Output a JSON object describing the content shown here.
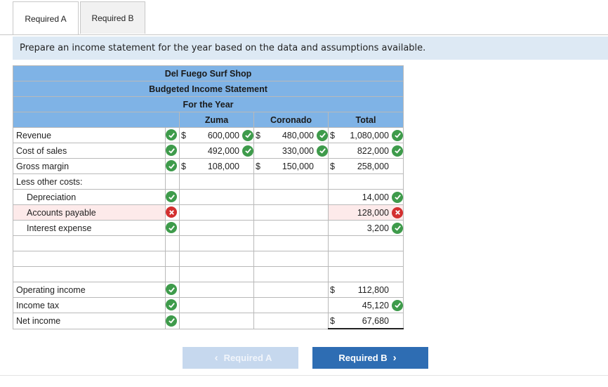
{
  "tabs": [
    {
      "label": "Required A"
    },
    {
      "label": "Required B"
    }
  ],
  "prompt": "Prepare an income statement for the year based on the data and assumptions available.",
  "statement": {
    "company": "Del Fuego Surf Shop",
    "title": "Budgeted Income Statement",
    "period": "For the Year",
    "columns": [
      "Zuma",
      "Coronado",
      "Total"
    ]
  },
  "rows": {
    "revenue": {
      "label": "Revenue",
      "zuma": "600,000",
      "coronado": "480,000",
      "total": "1,080,000"
    },
    "cost_of_sales": {
      "label": "Cost of sales",
      "zuma": "492,000",
      "coronado": "330,000",
      "total": "822,000"
    },
    "gross_margin": {
      "label": "Gross margin",
      "zuma": "108,000",
      "coronado": "150,000",
      "total": "258,000"
    },
    "less_other": {
      "label": "Less other costs:"
    },
    "depreciation": {
      "label": "Depreciation",
      "total": "14,000"
    },
    "accounts_payable": {
      "label": "Accounts payable",
      "total": "128,000"
    },
    "interest_expense": {
      "label": "Interest expense",
      "total": "3,200"
    },
    "operating_income": {
      "label": "Operating income",
      "total": "112,800"
    },
    "income_tax": {
      "label": "Income tax",
      "total": "45,120"
    },
    "net_income": {
      "label": "Net income",
      "total": "67,680"
    }
  },
  "currency_symbol": "$",
  "buttons": {
    "prev": "Required A",
    "next": "Required B"
  },
  "colors": {
    "header_blue": "#7fb3e6",
    "prompt_bg": "#dde9f4",
    "correct": "#3e9b4b",
    "incorrect": "#d32f2f",
    "button_primary": "#2e6db3"
  }
}
